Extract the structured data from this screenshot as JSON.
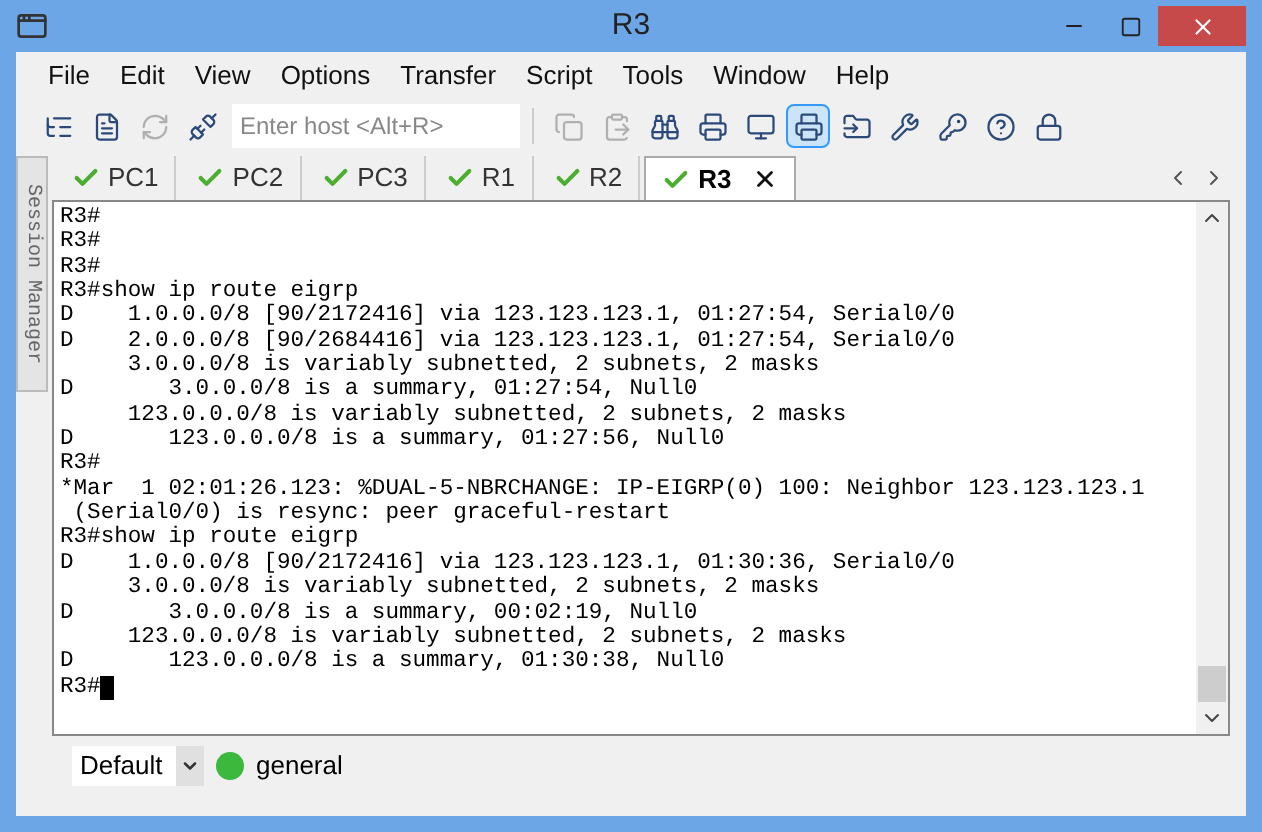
{
  "window": {
    "title": "R3"
  },
  "menu": [
    "File",
    "Edit",
    "View",
    "Options",
    "Transfer",
    "Script",
    "Tools",
    "Window",
    "Help"
  ],
  "toolbar": {
    "host_placeholder": "Enter host <Alt+R>",
    "before": [
      {
        "disabled": false,
        "pressed": false
      },
      {
        "disabled": false,
        "pressed": false
      },
      {
        "disabled": true,
        "pressed": false
      },
      {
        "disabled": false,
        "pressed": false
      }
    ],
    "after": [
      {
        "disabled": true,
        "pressed": false
      },
      {
        "disabled": true,
        "pressed": false
      },
      {
        "disabled": false,
        "pressed": false
      },
      {
        "disabled": false,
        "pressed": false
      },
      {
        "disabled": false,
        "pressed": false
      },
      {
        "disabled": false,
        "pressed": true
      },
      {
        "disabled": false,
        "pressed": false
      },
      {
        "disabled": false,
        "pressed": false
      },
      {
        "disabled": false,
        "pressed": false
      },
      {
        "disabled": false,
        "pressed": false
      },
      {
        "disabled": false,
        "pressed": false
      }
    ]
  },
  "session_manager": {
    "label": "Session Manager"
  },
  "tabs": [
    {
      "label": "PC1",
      "selected": false,
      "connected": true
    },
    {
      "label": "PC2",
      "selected": false,
      "connected": true
    },
    {
      "label": "PC3",
      "selected": false,
      "connected": true
    },
    {
      "label": "R1",
      "selected": false,
      "connected": true
    },
    {
      "label": "R2",
      "selected": false,
      "connected": true
    },
    {
      "label": "R3",
      "selected": true,
      "connected": true
    }
  ],
  "terminal": {
    "cursor": true,
    "lines": [
      "R3#",
      "R3#",
      "R3#",
      "R3#show ip route eigrp",
      "D    1.0.0.0/8 [90/2172416] via 123.123.123.1, 01:27:54, Serial0/0",
      "D    2.0.0.0/8 [90/2684416] via 123.123.123.1, 01:27:54, Serial0/0",
      "     3.0.0.0/8 is variably subnetted, 2 subnets, 2 masks",
      "D       3.0.0.0/8 is a summary, 01:27:54, Null0",
      "     123.0.0.0/8 is variably subnetted, 2 subnets, 2 masks",
      "D       123.0.0.0/8 is a summary, 01:27:56, Null0",
      "R3#",
      "*Mar  1 02:01:26.123: %DUAL-5-NBRCHANGE: IP-EIGRP(0) 100: Neighbor 123.123.123.1",
      " (Serial0/0) is resync: peer graceful-restart",
      "R3#show ip route eigrp",
      "D    1.0.0.0/8 [90/2172416] via 123.123.123.1, 01:30:36, Serial0/0",
      "     3.0.0.0/8 is variably subnetted, 2 subnets, 2 masks",
      "D       3.0.0.0/8 is a summary, 00:02:19, Null0",
      "     123.0.0.0/8 is variably subnetted, 2 subnets, 2 masks",
      "D       123.0.0.0/8 is a summary, 01:30:38, Null0",
      "R3#"
    ]
  },
  "status_bar": {
    "profile": "Default",
    "session": {
      "label": "general",
      "color": "#3cb83c"
    }
  }
}
